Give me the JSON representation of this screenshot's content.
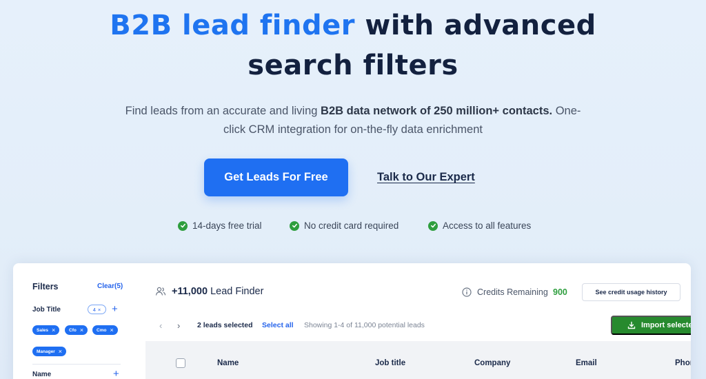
{
  "hero": {
    "title_accent": "B2B lead finder",
    "title_rest_1": "with advanced",
    "title_line2": "search filters",
    "subtitle_pre": "Find leads from an accurate and living",
    "subtitle_bold": "B2B data network of 250 million+ contacts.",
    "subtitle_post": "One-click CRM integration for on-the-fly data enrichment",
    "cta_primary": "Get Leads For Free",
    "cta_secondary": "Talk to Our Expert",
    "perks": [
      "14-days free trial",
      "No credit card required",
      "Access to all features"
    ]
  },
  "filters": {
    "title": "Filters",
    "clear": "Clear(5)",
    "job_title_label": "Job Title",
    "job_title_count": "4",
    "chips": [
      "Sales",
      "Cfo",
      "Cmo",
      "Manager"
    ],
    "name_label": "Name"
  },
  "toolbar": {
    "lead_count": "+11,000",
    "lead_label": "Lead Finder",
    "credits_label": "Credits Remaining",
    "credits_value": "900",
    "history_button": "See credit usage history",
    "selected": "2 leads selected",
    "select_all": "Select all",
    "showing": "Showing 1-4 of 11,000 potential leads",
    "import_button": "Import selecte"
  },
  "table": {
    "columns": [
      "Name",
      "Job title",
      "Company",
      "Email",
      "Phon"
    ]
  },
  "colors": {
    "accent": "#1f74f0",
    "primary_button": "#1f6ff2",
    "success": "#2e9e3e",
    "import_button": "#278a2e"
  }
}
